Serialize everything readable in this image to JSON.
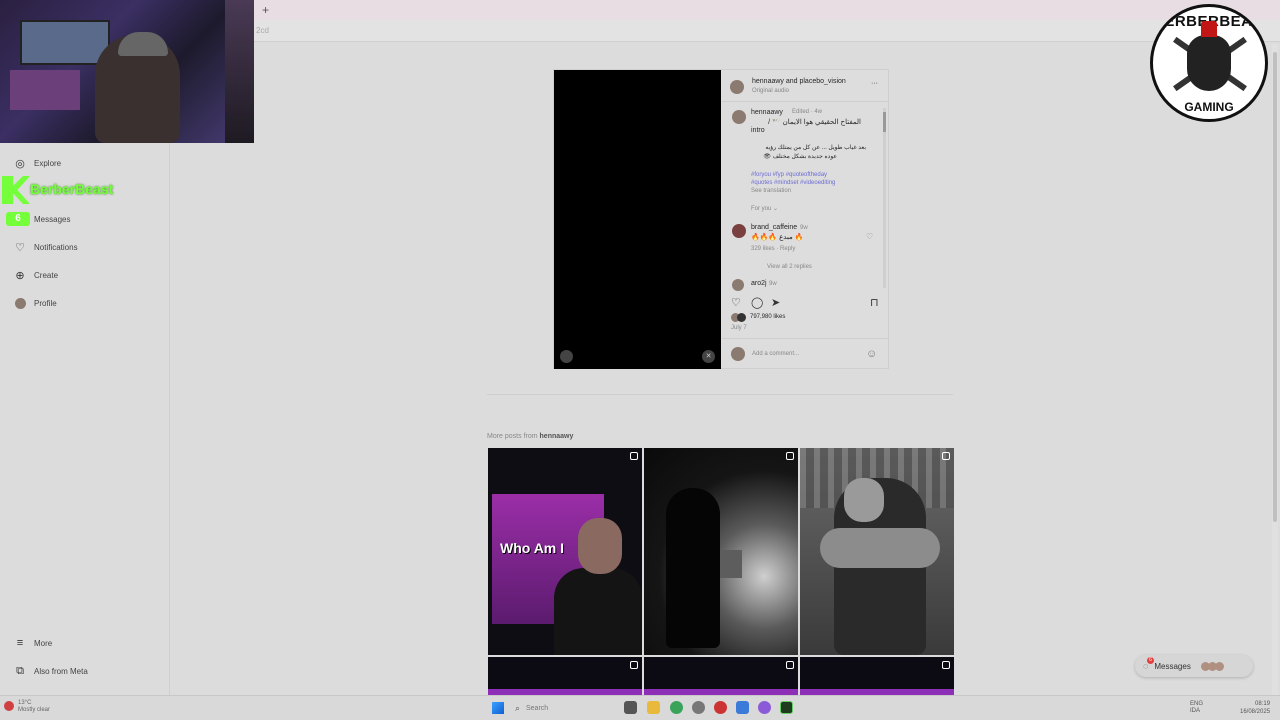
{
  "browser": {
    "new_tab": "+",
    "url": "2cd"
  },
  "overlay": {
    "streamer": "BerberBeast",
    "badge": "6"
  },
  "logo": {
    "top": "BERBERBEAST",
    "bottom": "GAMING"
  },
  "sidebar": {
    "items": [
      {
        "label": "Explore"
      },
      {
        "label": "Messages"
      },
      {
        "label": "Notifications"
      },
      {
        "label": "Create"
      },
      {
        "label": "Profile"
      }
    ],
    "more": "More",
    "meta": "Also from Meta"
  },
  "post": {
    "header": {
      "users": "hennaawy and placebo_vision",
      "audio": "Original audio",
      "menu": "···"
    },
    "caption": {
      "user": "hennaawy",
      "meta": "Edited · 4w",
      "line1": "المفتاح الحقيقي هوا الايمان 🕊️ /",
      "line2": "intro",
      "line3": "بعد غياب طويل ... عن كل من يمتلك رؤيه",
      "line4": "عوده جديدة بشكل مختلف 👁",
      "tags1": "#foryou #fyp #quoteoftheday",
      "tags2": "#quotes #mindset #videoediting",
      "see_translation": "See translation",
      "for_you": "For you ⌄"
    },
    "comment": {
      "user": "brand_caffeine",
      "time": "9w",
      "text": "🔥🔥🔥 مبدع 🔥",
      "meta": "329 likes · Reply",
      "view_replies": "View all 2 replies"
    },
    "comment2": {
      "user": "aro2j",
      "time": "9w"
    },
    "likes": "797,980 likes",
    "date": "July 7",
    "add_comment": "Add a comment..."
  },
  "more_posts": {
    "prefix": "More posts from",
    "user": "hennaawy"
  },
  "tile1": {
    "title": "Who Am I"
  },
  "messages_pill": {
    "label": "Messages",
    "count": "6"
  },
  "taskbar": {
    "weather_temp": "13°C",
    "weather_desc": "Mostly clear",
    "search": "Search",
    "lang": "ENG",
    "lang2": "IDA",
    "time": "08:19",
    "date": "16/08/2025"
  }
}
